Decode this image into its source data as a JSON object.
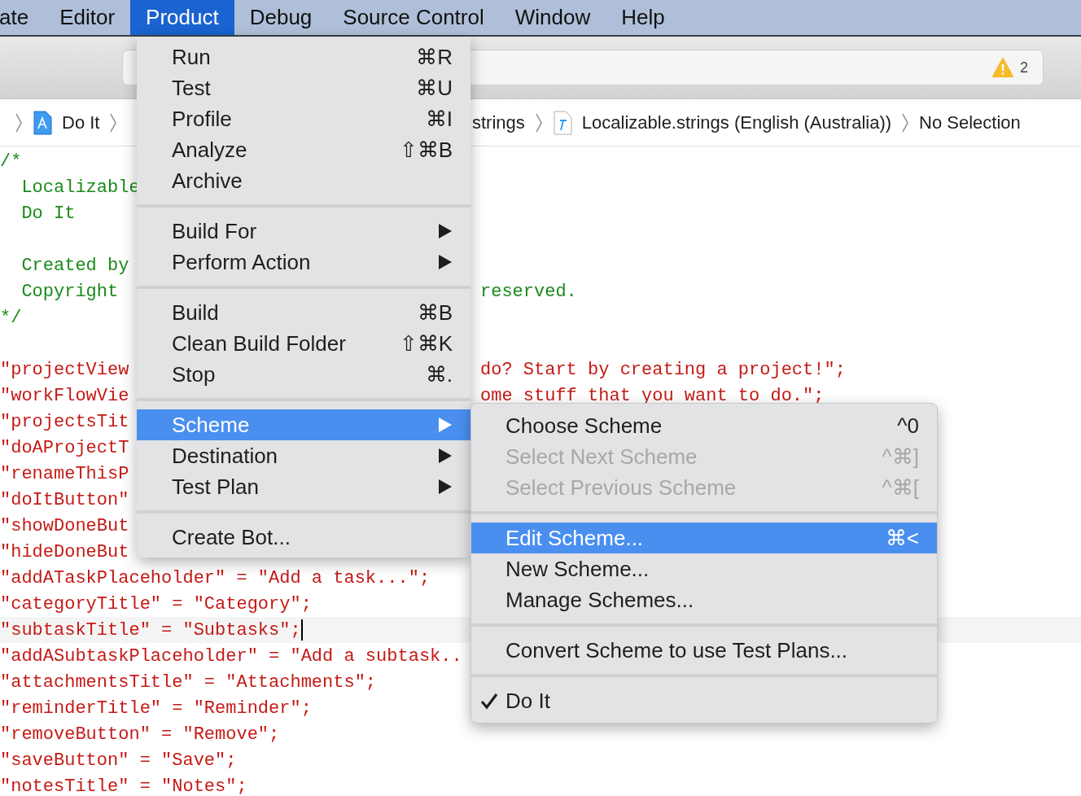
{
  "menubar": [
    {
      "label": "ate",
      "selected": false
    },
    {
      "label": "Editor",
      "selected": false
    },
    {
      "label": "Product",
      "selected": true
    },
    {
      "label": "Debug",
      "selected": false
    },
    {
      "label": "Source Control",
      "selected": false
    },
    {
      "label": "Window",
      "selected": false
    },
    {
      "label": "Help",
      "selected": false
    }
  ],
  "toolbar": {
    "warning_count": "2"
  },
  "jump_bar": {
    "left": [
      {
        "label": "Do It",
        "kind": "app"
      }
    ],
    "right": [
      {
        "label": "strings",
        "kind": "plain"
      },
      {
        "label": "Localizable.strings (English (Australia))",
        "kind": "file"
      },
      {
        "label": "No Selection",
        "kind": "plain"
      }
    ]
  },
  "editor": {
    "lines": [
      {
        "kind": "comment",
        "text": "/*"
      },
      {
        "kind": "comment",
        "text": "  Localizable"
      },
      {
        "kind": "comment",
        "text": "  Do It"
      },
      {
        "kind": "blank"
      },
      {
        "kind": "comment",
        "text": "  Created by"
      },
      {
        "kind": "comment",
        "text": "  Copyright",
        "tail": "reserved."
      },
      {
        "kind": "comment",
        "text": "*/"
      },
      {
        "kind": "blank"
      },
      {
        "kind": "string",
        "text": "\"projectView",
        "tail": "do? Start by creating a project!\";"
      },
      {
        "kind": "string",
        "text": "\"workFlowVie",
        "tail": "ome stuff that you want to do.\";"
      },
      {
        "kind": "string",
        "text": "\"projectsTit"
      },
      {
        "kind": "string",
        "text": "\"doAProjectT"
      },
      {
        "kind": "string",
        "text": "\"renameThisP"
      },
      {
        "kind": "string",
        "text": "\"doItButton\""
      },
      {
        "kind": "string",
        "text": "\"showDoneBut"
      },
      {
        "kind": "string",
        "text": "\"hideDoneBut"
      },
      {
        "kind": "string",
        "text": "\"addATaskPlaceholder\" = \"Add a task...\";"
      },
      {
        "kind": "string",
        "text": "\"categoryTitle\" = \"Category\";"
      },
      {
        "kind": "string",
        "text": "\"subtaskTitle\" = \"Subtasks\";",
        "current": true
      },
      {
        "kind": "string",
        "text": "\"addASubtaskPlaceholder\" = \"Add a subtask.."
      },
      {
        "kind": "string",
        "text": "\"attachmentsTitle\" = \"Attachments\";"
      },
      {
        "kind": "string",
        "text": "\"reminderTitle\" = \"Reminder\";"
      },
      {
        "kind": "string",
        "text": "\"removeButton\" = \"Remove\";"
      },
      {
        "kind": "string",
        "text": "\"saveButton\" = \"Save\";"
      },
      {
        "kind": "string",
        "text": "\"notesTitle\" = \"Notes\";"
      }
    ]
  },
  "product_menu": [
    {
      "kind": "item",
      "label": "Run",
      "shortcut": "⌘R",
      "submenu": false,
      "selected": false
    },
    {
      "kind": "item",
      "label": "Test",
      "shortcut": "⌘U",
      "submenu": false,
      "selected": false
    },
    {
      "kind": "item",
      "label": "Profile",
      "shortcut": "⌘I",
      "submenu": false,
      "selected": false
    },
    {
      "kind": "item",
      "label": "Analyze",
      "shortcut": "⇧⌘B",
      "submenu": false,
      "selected": false
    },
    {
      "kind": "item",
      "label": "Archive",
      "submenu": false,
      "selected": false
    },
    {
      "kind": "separator"
    },
    {
      "kind": "item",
      "label": "Build For",
      "submenu": true,
      "selected": false
    },
    {
      "kind": "item",
      "label": "Perform Action",
      "submenu": true,
      "selected": false
    },
    {
      "kind": "separator"
    },
    {
      "kind": "item",
      "label": "Build",
      "shortcut": "⌘B",
      "submenu": false,
      "selected": false
    },
    {
      "kind": "item",
      "label": "Clean Build Folder",
      "shortcut": "⇧⌘K",
      "submenu": false,
      "selected": false
    },
    {
      "kind": "item",
      "label": "Stop",
      "shortcut": "⌘.",
      "submenu": false,
      "selected": false
    },
    {
      "kind": "separator"
    },
    {
      "kind": "item",
      "label": "Scheme",
      "submenu": true,
      "selected": true
    },
    {
      "kind": "item",
      "label": "Destination",
      "submenu": true,
      "selected": false
    },
    {
      "kind": "item",
      "label": "Test Plan",
      "submenu": true,
      "selected": false
    },
    {
      "kind": "separator"
    },
    {
      "kind": "item",
      "label": "Create Bot...",
      "submenu": false,
      "selected": false
    }
  ],
  "scheme_submenu": [
    {
      "kind": "item",
      "label": "Choose Scheme",
      "shortcut": "^0",
      "disabled": false,
      "checked": false,
      "selected": false
    },
    {
      "kind": "item",
      "label": "Select Next Scheme",
      "shortcut": "^⌘]",
      "disabled": true,
      "checked": false,
      "selected": false
    },
    {
      "kind": "item",
      "label": "Select Previous Scheme",
      "shortcut": "^⌘[",
      "disabled": true,
      "checked": false,
      "selected": false
    },
    {
      "kind": "separator"
    },
    {
      "kind": "item",
      "label": "Edit Scheme...",
      "shortcut": "⌘<",
      "disabled": false,
      "checked": false,
      "selected": true
    },
    {
      "kind": "item",
      "label": "New Scheme...",
      "disabled": false,
      "checked": false,
      "selected": false
    },
    {
      "kind": "item",
      "label": "Manage Schemes...",
      "disabled": false,
      "checked": false,
      "selected": false
    },
    {
      "kind": "separator"
    },
    {
      "kind": "item",
      "label": "Convert Scheme to use Test Plans...",
      "disabled": false,
      "checked": false,
      "selected": false
    },
    {
      "kind": "separator"
    },
    {
      "kind": "item",
      "label": "Do It",
      "disabled": false,
      "checked": true,
      "selected": false
    }
  ]
}
